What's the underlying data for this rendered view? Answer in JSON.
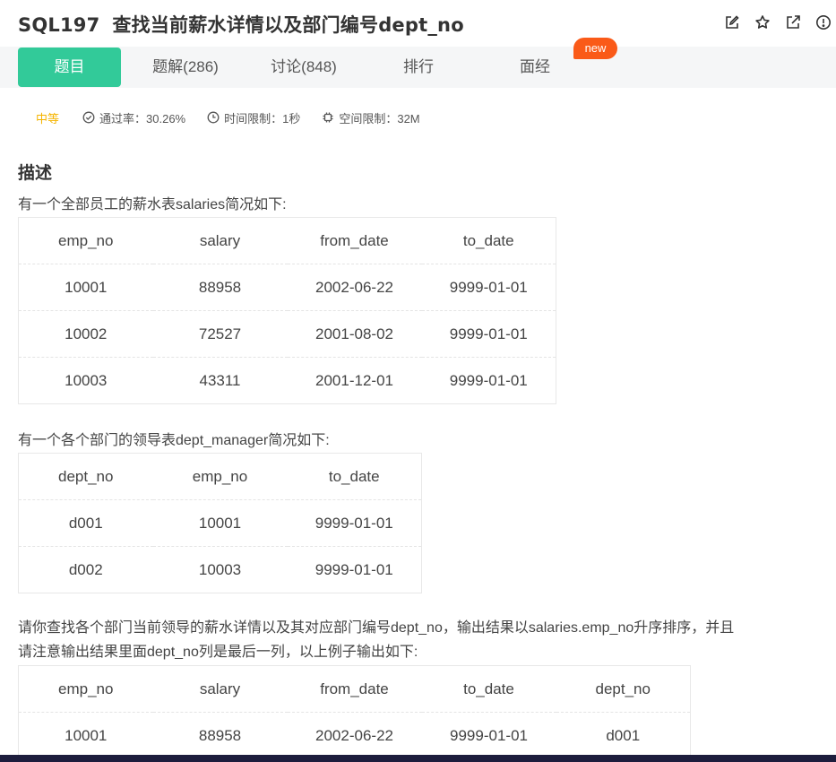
{
  "header": {
    "code": "SQL197",
    "title": "查找当前薪水详情以及部门编号dept_no",
    "icons": [
      "edit-icon",
      "star-icon",
      "share-icon",
      "info-icon"
    ]
  },
  "tabs": [
    {
      "label": "题目",
      "active": true
    },
    {
      "label": "题解(286)",
      "active": false
    },
    {
      "label": "讨论(848)",
      "active": false
    },
    {
      "label": "排行",
      "active": false
    },
    {
      "label": "面经",
      "active": false
    }
  ],
  "badge": "new",
  "meta": {
    "level": "中等",
    "pass_rate": "通过率：30.26%",
    "time_limit": "时间限制：1秒",
    "space_limit": "空间限制：32M"
  },
  "description": {
    "heading": "描述",
    "intro1": "有一个全部员工的薪水表salaries简况如下:",
    "intro2": "有一个各个部门的领导表dept_manager简况如下:",
    "task_line1": "请你查找各个部门当前领导的薪水详情以及其对应部门编号dept_no，输出结果以salaries.emp_no升序排序，并且",
    "task_line2": "请注意输出结果里面dept_no列是最后一列，以上例子输出如下:"
  },
  "salaries_table": {
    "headers": [
      "emp_no",
      "salary",
      "from_date",
      "to_date"
    ],
    "rows": [
      [
        "10001",
        "88958",
        "2002-06-22",
        "9999-01-01"
      ],
      [
        "10002",
        "72527",
        "2001-08-02",
        "9999-01-01"
      ],
      [
        "10003",
        "43311",
        "2001-12-01",
        "9999-01-01"
      ]
    ]
  },
  "dept_manager_table": {
    "headers": [
      "dept_no",
      "emp_no",
      "to_date"
    ],
    "rows": [
      [
        "d001",
        "10001",
        "9999-01-01"
      ],
      [
        "d002",
        "10003",
        "9999-01-01"
      ]
    ]
  },
  "output_table": {
    "headers": [
      "emp_no",
      "salary",
      "from_date",
      "to_date",
      "dept_no"
    ],
    "rows": [
      [
        "10001",
        "88958",
        "2002-06-22",
        "9999-01-01",
        "d001"
      ]
    ]
  },
  "colors": {
    "accent": "#32ca99",
    "badge": "#fa5a18",
    "level": "#f5b400"
  }
}
